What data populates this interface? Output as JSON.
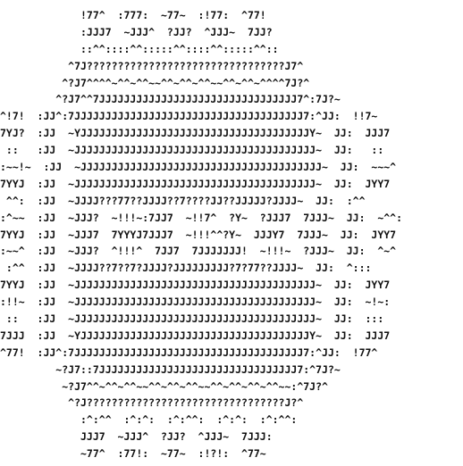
{
  "ascii_art": {
    "lines": [
      "             !77^  :777:  ~77~  :!77:  ^77!",
      "             :JJJ7  ~JJJ^  ?JJ?  ^JJJ~  7JJ?",
      "             ::^^::::^^:::::^^::::^^:::::^^::",
      "           ^7J????????????????????????????????J7^",
      "          ^?J7^^^^~^^~^^~~^^~^^~^^~~^^~^^~^^^^7J?^",
      "         ^?J7^^7JJJJJJJJJJJJJJJJJJJJJJJJJJJJJJJJ7^:7J?~",
      "^!7!  :JJ^:7JJJJJJJJJJJJJJJJJJJJJJJJJJJJJJJJJJJJJ7:^JJ:  !!7~",
      "7YJ?  :JJ  ~YJJJJJJJJJJJJJJJJJJJJJJJJJJJJJJJJJJJJJY~  JJ:  JJJ7",
      " ::   :JJ  ~JJJJJJJJJJJJJJJJJJJJJJJJJJJJJJJJJJJJJJJ~  JJ:   ::",
      ":~~!~  :JJ  ~JJJJJJJJJJJJJJJJJJJJJJJJJJJJJJJJJJJJJJJ~  JJ:  ~~~^",
      "7YYJ  :JJ  ~JJJJJJJJJJJJJJJJJJJJJJJJJJJJJJJJJJJJJJJ~  JJ:  JYY7",
      " ^^:  :JJ  ~JJJJ???77??JJJJ??7????JJ??JJJJJ?JJJJ~  JJ:  :^^",
      ":^~~  :JJ  ~JJJ?  ~!!!~:7JJ7  ~!!7^  ?Y~  ?JJJ7  7JJJ~  JJ:  ~^^:",
      "7YYJ  :JJ  ~JJJ7  7YYYJ7JJJ7  ~!!!^^?Y~  JJJY7  7JJJ~  JJ:  JYY7",
      ":~~^  :JJ  ~JJJ?  ^!!!^  7JJ7  7JJJJJJJ!  ~!!!~  ?JJJ~  JJ:  ^~^",
      " :^^  :JJ  ~JJJJ??7??7?JJJJ?JJJJJJJJJ?7?77??JJJJ~  JJ:  ^:::",
      "7YYJ  :JJ  ~JJJJJJJJJJJJJJJJJJJJJJJJJJJJJJJJJJJJJJJ~  JJ:  JYY7",
      ":!!~  :JJ  ~JJJJJJJJJJJJJJJJJJJJJJJJJJJJJJJJJJJJJJJ~  JJ:  ~!~:",
      " ::   :JJ  ~JJJJJJJJJJJJJJJJJJJJJJJJJJJJJJJJJJJJJJJ~  JJ:  :::",
      "7JJJ  :JJ  ~YJJJJJJJJJJJJJJJJJJJJJJJJJJJJJJJJJJJJJY~  JJ:  JJJ7",
      "^77!  :JJ^:7JJJJJJJJJJJJJJJJJJJJJJJJJJJJJJJJJJJJJ7:^JJ:  !77^",
      "         ~?J7::7JJJJJJJJJJJJJJJJJJJJJJJJJJJJJJJJ7:^7J?~",
      "          ~?J7^^~^^~^^~~^^~^^~^^~~^^~^^~^^~^^~~:^7J?^",
      "           ^?J????????????????????????????????J?^",
      "             :^:^^  :^:^:  :^:^^:  :^:^:  :^:^^:",
      "             JJJ7  ~JJJ^  ?JJ?  ^JJJ~  7JJJ:",
      "             ~77^  :77!:  ~77~  :!?!:  ^77~"
    ]
  }
}
